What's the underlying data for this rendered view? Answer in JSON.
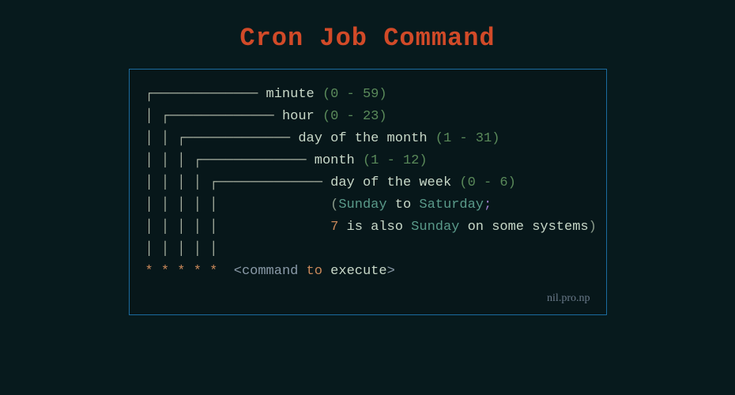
{
  "title": "Cron Job Command",
  "fields": {
    "minute": {
      "label": "minute",
      "range": "(0 - 59)"
    },
    "hour": {
      "label": "hour",
      "range": "(0 - 23)"
    },
    "dom": {
      "label": "day of the month",
      "range": "(1 - 31)"
    },
    "month": {
      "label": "month",
      "range": "(1 - 12)"
    },
    "dow": {
      "label": "day of the week",
      "range": "(0 - 6)"
    }
  },
  "dow_extra": {
    "open": "(",
    "sunday": "Sunday",
    "to": " to ",
    "saturday": "Saturday",
    "semi": ";",
    "seven": "7",
    "mid": " is also ",
    "sunday2": "Sunday",
    "tail": " on some systems",
    "close": ")"
  },
  "expression": {
    "stars": "* * * * *",
    "open": "<",
    "command": "command",
    "to": " to ",
    "execute": "execute",
    "close": ">"
  },
  "credit": "nil.pro.np"
}
